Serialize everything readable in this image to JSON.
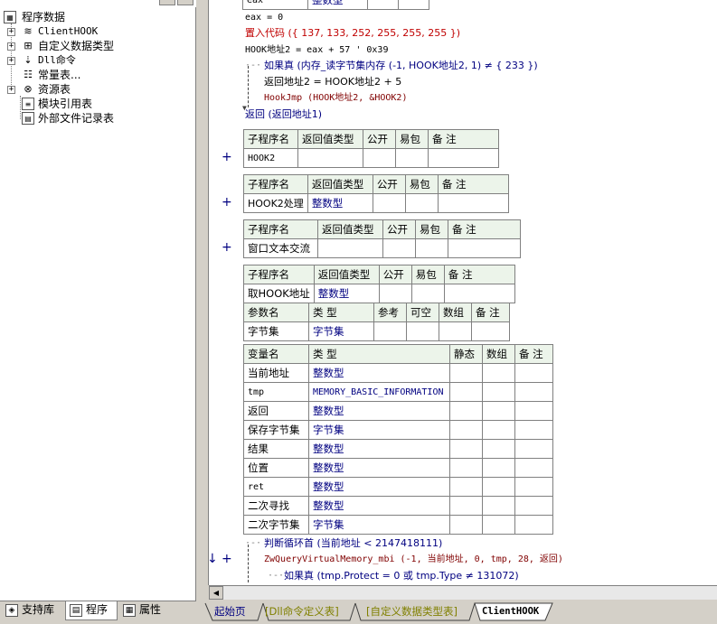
{
  "tree": {
    "root": "程序数据",
    "items": [
      {
        "label": "ClientHOOK",
        "icon": "module-icon",
        "expandable": true
      },
      {
        "label": "自定义数据类型",
        "icon": "datatype-icon",
        "expandable": true
      },
      {
        "label": "Dll命令",
        "icon": "dll-icon",
        "expandable": true
      },
      {
        "label": "常量表...",
        "icon": "constant-icon",
        "expandable": false
      },
      {
        "label": "资源表",
        "icon": "resource-icon",
        "expandable": true
      },
      {
        "label": "模块引用表",
        "icon": "module-ref-icon",
        "expandable": false
      },
      {
        "label": "外部文件记录表",
        "icon": "file-record-icon",
        "expandable": false
      }
    ]
  },
  "left_tabs": [
    "支持库",
    "程序",
    "属性"
  ],
  "code": {
    "top_fragment_left": "eax",
    "top_fragment_right": "整数型",
    "lines": [
      "eax = 0",
      "置入代码 ({ 137, 133, 252, 255, 255, 255 })",
      "HOOK地址2 = eax + 57  ' 0x39",
      "如果真 (内存_读字节集内存 (-1, HOOK地址2, 1) ≠ { 233 })",
      "返回地址2 = HOOK地址2 + 5",
      "HookJmp (HOOK地址2, &HOOK2)",
      "返回 (返回地址1)"
    ]
  },
  "sub_header": {
    "name": "子程序名",
    "ret": "返回值类型",
    "public": "公开",
    "easy": "易包",
    "note": "备 注"
  },
  "param_header": {
    "name": "参数名",
    "type": "类 型",
    "ref": "参考",
    "nullable": "可空",
    "array": "数组",
    "note": "备 注"
  },
  "var_header": {
    "name": "变量名",
    "type": "类 型",
    "static": "静态",
    "array": "数组",
    "note": "备 注"
  },
  "subs": [
    {
      "name": "HOOK2",
      "ret": ""
    },
    {
      "name": "HOOK2处理",
      "ret": "整数型"
    },
    {
      "name": "窗口文本交流",
      "ret": ""
    },
    {
      "name": "取HOOK地址",
      "ret": "整数型"
    }
  ],
  "params": [
    {
      "name": "字节集",
      "type": "字节集"
    }
  ],
  "vars": [
    {
      "name": "当前地址",
      "type": "整数型"
    },
    {
      "name": "tmp",
      "type": "MEMORY_BASIC_INFORMATION"
    },
    {
      "name": "返回",
      "type": "整数型"
    },
    {
      "name": "保存字节集",
      "type": "字节集"
    },
    {
      "name": "结果",
      "type": "整数型"
    },
    {
      "name": "位置",
      "type": "整数型"
    },
    {
      "name": "ret",
      "type": "整数型"
    },
    {
      "name": "二次寻找",
      "type": "整数型"
    },
    {
      "name": "二次字节集",
      "type": "字节集"
    }
  ],
  "code2": [
    "判断循环首 (当前地址 < 2147418111)",
    "ZwQueryVirtualMemory_mbi (-1, 当前地址, 0, tmp, 28, 返回)",
    "如果真 (tmp.Protect = 0 或 tmp.Type ≠ 131072)"
  ],
  "right_tabs": [
    "起始页",
    "[Dll命令定义表]",
    "[自定义数据类型表]",
    "ClientHOOK"
  ]
}
